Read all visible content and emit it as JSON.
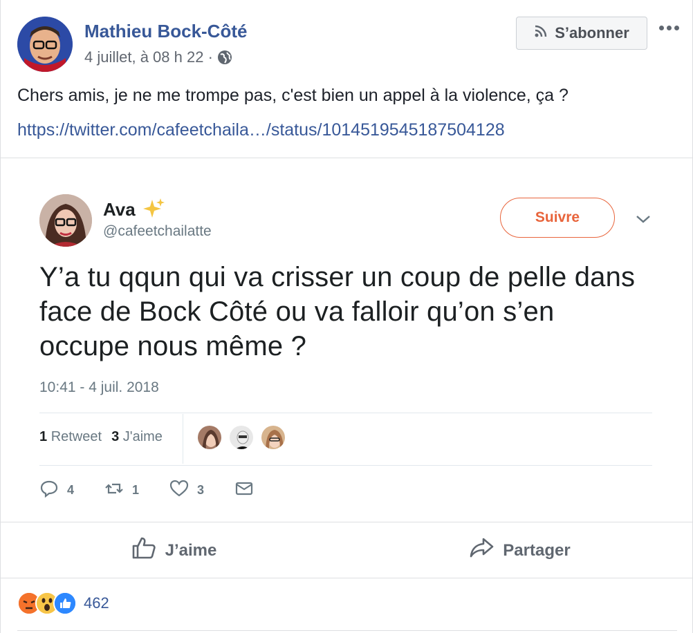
{
  "post": {
    "author": "Mathieu Bock-Côté",
    "timestamp": "4 juillet, à 08 h 22 ·",
    "privacy_icon": "globe-icon",
    "follow_label": "S’abonner",
    "text": "Chers amis, je ne me trompe pas, c'est bien un appel à la violence, ça ?",
    "link_text": "https://twitter.com/cafeetchaila…/status/1014519545187504128"
  },
  "tweet": {
    "name": "Ava",
    "handle": "@cafeetchailatte",
    "follow_label": "Suivre",
    "text": "Y’a tu qqun qui va crisser un coup de pelle dans face de Bock Côté ou va falloir qu’on s’en occupe nous même ?",
    "date": "10:41 - 4 juil. 2018",
    "retweet_count": "1",
    "retweet_label": "Retweet",
    "like_count": "3",
    "like_label": "J'aime",
    "actions": {
      "reply_count": "4",
      "retweet_count": "1",
      "like_count": "3"
    },
    "accent_color": "#e8643b"
  },
  "fb_actions": {
    "like_label": "J’aime",
    "share_label": "Partager"
  },
  "reactions": {
    "types": [
      "angry",
      "wow",
      "like"
    ],
    "count": "462"
  },
  "colors": {
    "fb_blue": "#385898",
    "muted": "#616770"
  }
}
